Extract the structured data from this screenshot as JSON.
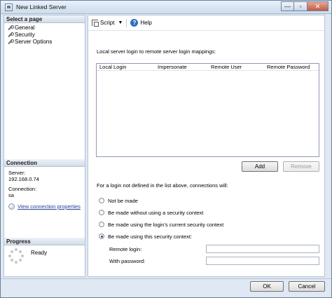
{
  "window": {
    "title": "New Linked Server",
    "minimize_glyph": "—",
    "restore_glyph": "▫",
    "close_glyph": "✕"
  },
  "sidebar": {
    "select_page_header": "Select a page",
    "pages": [
      {
        "label": "General",
        "icon": "wrench-icon"
      },
      {
        "label": "Security",
        "icon": "wrench-icon"
      },
      {
        "label": "Server Options",
        "icon": "wrench-icon"
      }
    ],
    "connection_header": "Connection",
    "server_label": "Server:",
    "server_value": "192.168.0.74",
    "connection_label": "Connection:",
    "connection_value": "sa",
    "view_connection_link": "View connection properties",
    "progress_header": "Progress",
    "progress_status": "Ready"
  },
  "toolbar": {
    "script_label": "Script",
    "script_arrow": "▼",
    "help_label": "Help",
    "help_glyph": "?"
  },
  "security": {
    "mapping_label": "Local server login to remote server login mappings:",
    "grid_columns": [
      "Local Login",
      "Impersonate",
      "Remote User",
      "Remote Password"
    ],
    "add_button": "Add",
    "remove_button": "Remove",
    "question": "For a login not defined in the list above, connections will:",
    "options": [
      {
        "label": "Not be made",
        "checked": false
      },
      {
        "label": "Be made without using a security context",
        "checked": false
      },
      {
        "label": "Be made using the login's current security context",
        "checked": false
      },
      {
        "label": "Be made using this security context:",
        "checked": true
      }
    ],
    "remote_login_label": "Remote login:",
    "remote_login_value": "",
    "password_label": "With password:",
    "password_value": ""
  },
  "footer": {
    "ok_button": "OK",
    "cancel_button": "Cancel"
  }
}
